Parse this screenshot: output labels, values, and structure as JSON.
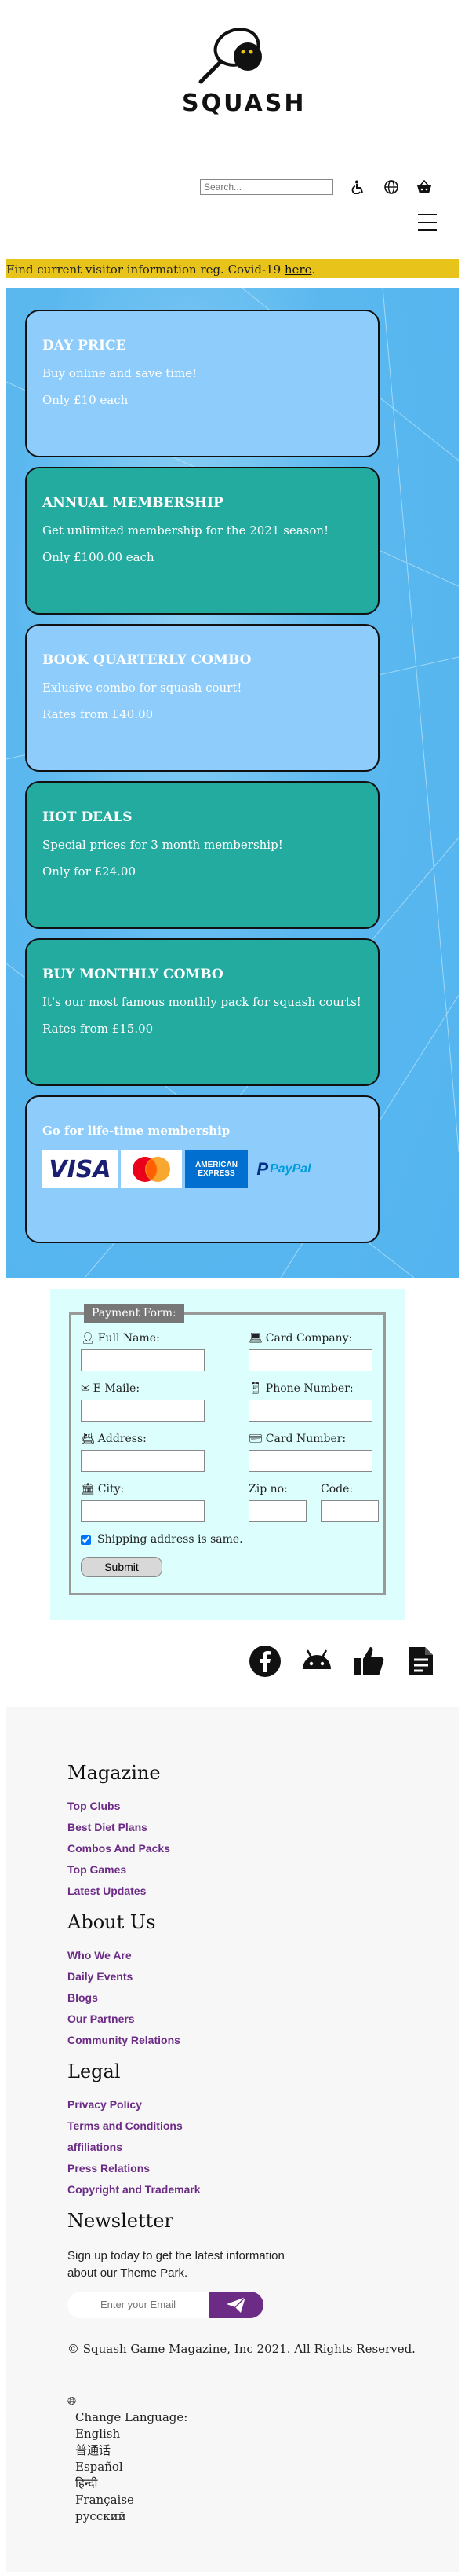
{
  "logo": {
    "text": "SQUASH",
    "icon": "squash-racket-ball-logo"
  },
  "search": {
    "placeholder": "Search..."
  },
  "header_icons": [
    "accessibility-icon",
    "globe-icon",
    "basket-icon",
    "hamburger-menu-icon"
  ],
  "covid": {
    "text": "Find current visitor information reg. Covid-19 ",
    "link": "here",
    "end": "."
  },
  "cards": [
    {
      "title": "DAY PRICE",
      "line1": "Buy online and save time!",
      "line2": "Only £10 each"
    },
    {
      "title": "ANNUAL MEMBERSHIP",
      "line1": "Get unlimited membership for the 2021 season!",
      "line2": "Only £100.00 each"
    },
    {
      "title": "BOOK QUARTERLY COMBO",
      "line1": "Exlusive combo for squash court!",
      "line2": "Rates from £40.00"
    },
    {
      "title": "HOT DEALS",
      "line1": "Special prices for 3 month membership!",
      "line2": "Only for £24.00"
    },
    {
      "title": "BUY MONTHLY COMBO",
      "line1": "It's our most famous monthly pack for squash courts!",
      "line2": "Rates from £15.00"
    }
  ],
  "lifetime": {
    "title": "Go for life-time membership",
    "logos": [
      "VISA",
      "AMERICAN EXPRESS",
      "PayPal"
    ]
  },
  "colors": {
    "card_blue": "#8ecdfb",
    "card_teal": "#23aba0",
    "covid_bar": "#e8c41a",
    "link_purple": "#6c2c86",
    "form_bg": "#dcfffe"
  },
  "form": {
    "legend": "Payment Form:",
    "full_name": "Full Name:",
    "card_company": "Card Company:",
    "email": "E Maile:",
    "phone": "Phone Number:",
    "address": "Address:",
    "card_number": "Card Number:",
    "city": "City:",
    "zip": "Zip no:",
    "code": "Code:",
    "shipping": "Shipping address is same.",
    "submit": "Submit"
  },
  "social_icons": [
    "facebook-icon",
    "android-icon",
    "thumbs-up-icon",
    "document-icon"
  ],
  "footer": {
    "magazine": {
      "title": "Magazine",
      "items": [
        "Top Clubs",
        "Best Diet Plans",
        "Combos And Packs",
        "Top Games",
        "Latest Updates"
      ]
    },
    "about": {
      "title": "About Us",
      "items": [
        "Who We Are",
        "Daily Events",
        "Blogs",
        "Our Partners",
        "Community Relations"
      ]
    },
    "legal": {
      "title": "Legal",
      "items": [
        "Privacy Policy",
        "Terms and Conditions",
        "affiliations",
        "Press Relations",
        "Copyright and Trademark"
      ]
    },
    "newsletter": {
      "title": "Newsletter",
      "text": "Sign up today to get the latest information about our Theme Park.",
      "placeholder": "Enter your Email"
    },
    "copyright": "© Squash Game Magazine, Inc 2021. All Rights Reserved.",
    "language": {
      "label": "Change Language:",
      "options": [
        "English",
        "普通话",
        "Español",
        "हिन्दी",
        "Française",
        "русский"
      ]
    }
  }
}
